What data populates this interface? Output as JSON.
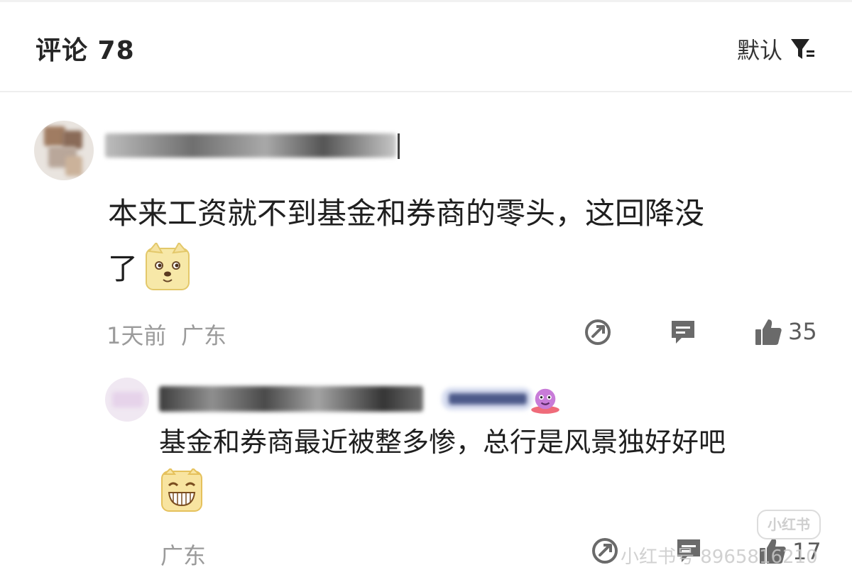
{
  "header": {
    "title": "评论 78",
    "sort_label": "默认"
  },
  "comment": {
    "text_line1": "本来工资就不到基金和券商的零头，这回降没",
    "text_line2": "了",
    "time": "1天前",
    "location": "广东",
    "like_count": "35"
  },
  "reply": {
    "text": "基金和券商最近被整多惨，总行是风景独好好吧",
    "location": "广东",
    "like_count": "17"
  },
  "watermark": {
    "badge": "小红书",
    "text": "小红书号 8965816210"
  },
  "icons": {
    "filter": "filter-icon",
    "share": "share-icon",
    "reply": "comment-bubble-icon",
    "like": "thumbs-up-icon"
  }
}
